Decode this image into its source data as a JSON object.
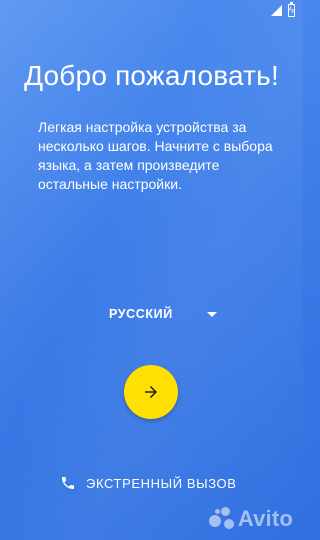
{
  "title": "Добро пожаловать!",
  "subtitle": "Легкая настройка устройства за несколько шагов. Начните с выбора языка, а затем произведите остальные настройки.",
  "language_select": {
    "selected": "РУССКИЙ"
  },
  "next_button": {
    "icon": "arrow-right-icon"
  },
  "emergency_call": {
    "label": "ЭКСТРЕННЫЙ ВЫЗОВ",
    "icon": "phone-icon"
  },
  "watermark": {
    "text": "Avito"
  },
  "colors": {
    "background": "#3d7de8",
    "accent": "#ffe000"
  }
}
